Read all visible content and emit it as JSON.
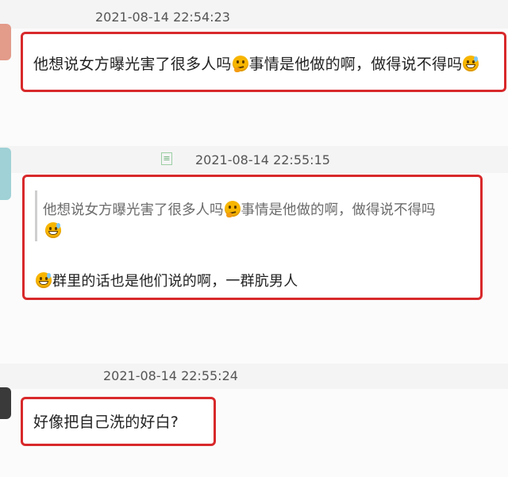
{
  "messages": [
    {
      "timestamp": "2021-08-14 22:54:23",
      "text_1": "他想说女方曝光害了很多人吗",
      "text_2": "事情是他做的啊，做得说不得吗",
      "emojis": [
        "thinking-face",
        "grinning-sweat"
      ]
    },
    {
      "timestamp": "2021-08-14 22:55:15",
      "quote_1": "他想说女方曝光害了很多人吗",
      "quote_2": "事情是他做的啊，做得说不得吗",
      "reply": "群里的话也是他们说的啊，一群肮男人",
      "emojis": [
        "thinking-face",
        "grinning-sweat",
        "grinning-sweat"
      ]
    },
    {
      "timestamp": "2021-08-14 22:55:24",
      "text": "好像把自己洗的好白?"
    }
  ],
  "colors": {
    "highlight_border": "#d8292b",
    "timestamp": "#555555",
    "quote_text": "#6b6b6b"
  }
}
